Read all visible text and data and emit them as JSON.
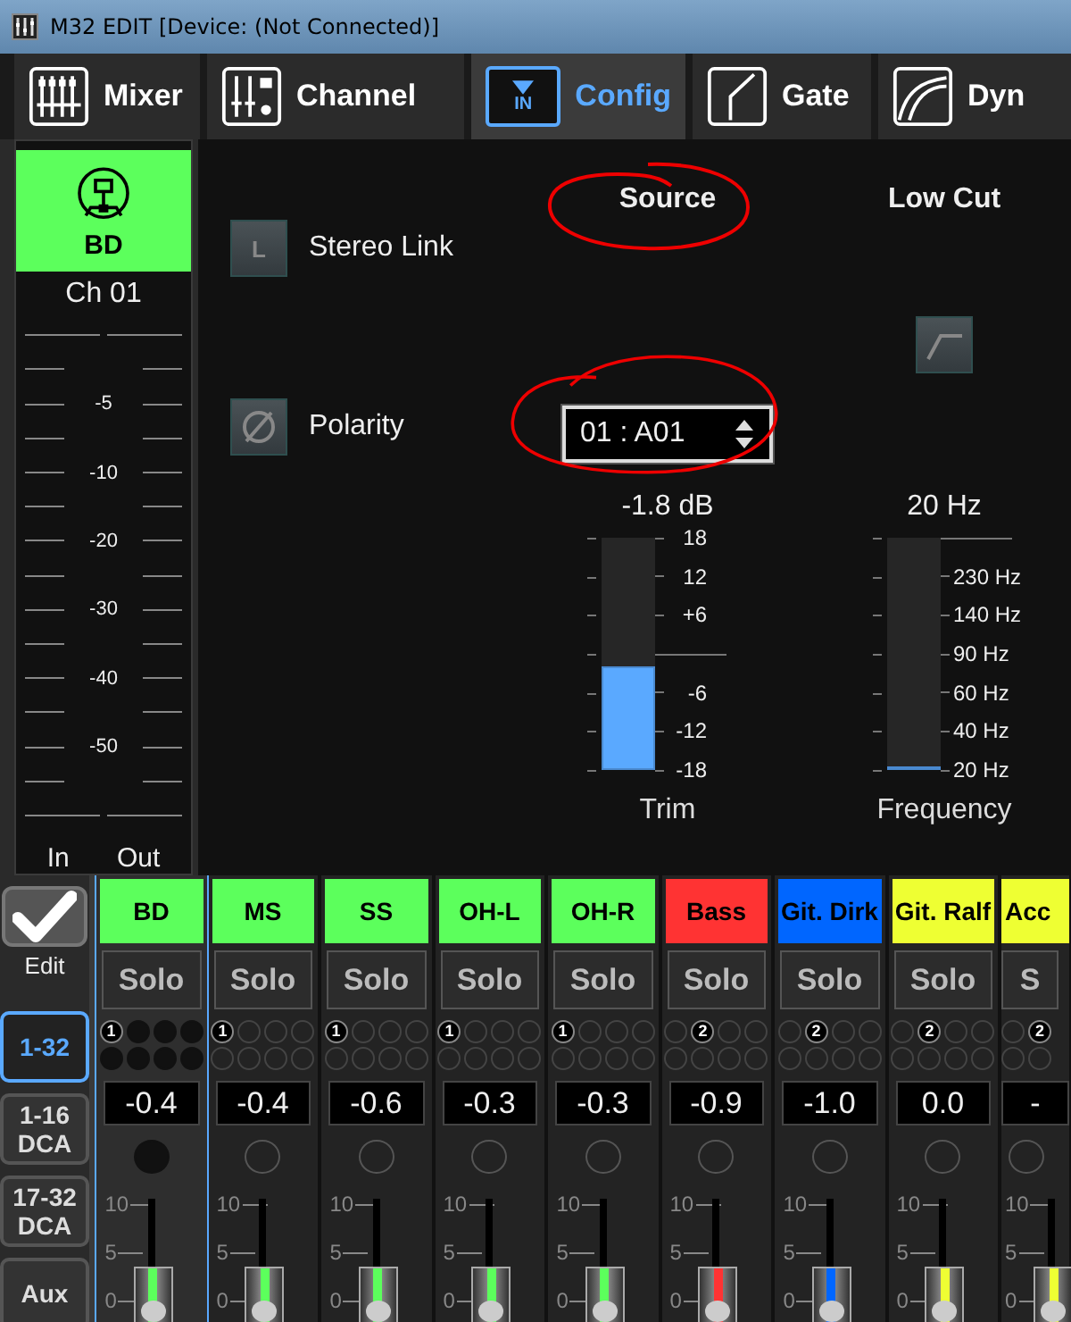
{
  "window": {
    "title": "M32 EDIT [Device: (Not Connected)]"
  },
  "tabs": [
    {
      "kind": "mixer",
      "label": "Mixer",
      "selected": false
    },
    {
      "kind": "channel",
      "label": "Channel",
      "selected": false
    },
    {
      "kind": "config",
      "label": "Config",
      "icon_text": "IN",
      "selected": true
    },
    {
      "kind": "gate",
      "label": "Gate",
      "selected": false
    },
    {
      "kind": "dyn",
      "label": "Dyn",
      "selected": false
    }
  ],
  "channel_panel": {
    "name": "BD",
    "color": "#5cff5c",
    "number": "Ch 01",
    "meter_labels": [
      "-5",
      "-10",
      "-20",
      "-30",
      "-40",
      "-50"
    ],
    "in_label": "In",
    "out_label": "Out"
  },
  "config": {
    "stereo_link": {
      "icon_text": "L",
      "label": "Stereo Link",
      "on": false
    },
    "polarity": {
      "label": "Polarity",
      "on": false
    },
    "source": {
      "title": "Source",
      "value": "01 : A01",
      "reading": "-1.8 dB",
      "label": "Trim",
      "level": 0.45,
      "ticks": [
        {
          "kind": "label",
          "label": "18"
        },
        {
          "kind": "label",
          "label": "12"
        },
        {
          "kind": "label",
          "label": "+6"
        },
        {
          "kind": "line"
        },
        {
          "kind": "label",
          "label": "-6"
        },
        {
          "kind": "label",
          "label": "-12"
        },
        {
          "kind": "label",
          "label": "-18"
        }
      ]
    },
    "low_cut": {
      "title": "Low Cut",
      "on": false,
      "reading": "20 Hz",
      "label": "Frequency",
      "level": 0,
      "ticks": [
        {
          "kind": "line"
        },
        {
          "kind": "label",
          "label": "230 Hz"
        },
        {
          "kind": "label",
          "label": "140 Hz"
        },
        {
          "kind": "label",
          "label": "90 Hz"
        },
        {
          "kind": "label",
          "label": "60 Hz"
        },
        {
          "kind": "label",
          "label": "40 Hz"
        },
        {
          "kind": "label",
          "label": "20 Hz"
        }
      ]
    }
  },
  "edit_button": {
    "label": "Edit"
  },
  "banks": [
    {
      "label": "1-32",
      "selected": true
    },
    {
      "label": "1-16 DCA",
      "selected": false
    },
    {
      "label": "17-32 DCA",
      "selected": false
    },
    {
      "label": "Aux",
      "selected": false
    }
  ],
  "strips": [
    {
      "name": "BD",
      "color": "#5cff5c",
      "selected": true,
      "solo_label": "Solo",
      "solo": false,
      "dots": [
        {
          "assigned": true,
          "label": "1"
        },
        {
          "assigned": false
        },
        {
          "assigned": false
        },
        {
          "assigned": false
        }
      ],
      "value": "-0.4",
      "scale": [
        "10",
        "5",
        "0"
      ]
    },
    {
      "name": "MS",
      "color": "#5cff5c",
      "selected": false,
      "solo_label": "Solo",
      "solo": false,
      "dots": [
        {
          "assigned": true,
          "label": "1"
        },
        {
          "assigned": false
        },
        {
          "assigned": false
        },
        {
          "assigned": false
        }
      ],
      "value": "-0.4",
      "scale": [
        "10",
        "5",
        "0"
      ]
    },
    {
      "name": "SS",
      "color": "#5cff5c",
      "selected": false,
      "solo_label": "Solo",
      "solo": false,
      "dots": [
        {
          "assigned": true,
          "label": "1"
        },
        {
          "assigned": false
        },
        {
          "assigned": false
        },
        {
          "assigned": false
        }
      ],
      "value": "-0.6",
      "scale": [
        "10",
        "5",
        "0"
      ]
    },
    {
      "name": "OH-L",
      "color": "#5cff5c",
      "selected": false,
      "solo_label": "Solo",
      "solo": false,
      "dots": [
        {
          "assigned": true,
          "label": "1"
        },
        {
          "assigned": false
        },
        {
          "assigned": false
        },
        {
          "assigned": false
        }
      ],
      "value": "-0.3",
      "scale": [
        "10",
        "5",
        "0"
      ]
    },
    {
      "name": "OH-R",
      "color": "#5cff5c",
      "selected": false,
      "solo_label": "Solo",
      "solo": false,
      "dots": [
        {
          "assigned": true,
          "label": "1"
        },
        {
          "assigned": false
        },
        {
          "assigned": false
        },
        {
          "assigned": false
        }
      ],
      "value": "-0.3",
      "scale": [
        "10",
        "5",
        "0"
      ]
    },
    {
      "name": "Bass",
      "color": "#ff3333",
      "selected": false,
      "solo_label": "Solo",
      "solo": false,
      "dots": [
        {
          "assigned": false
        },
        {
          "assigned": true,
          "label": "2"
        },
        {
          "assigned": false
        },
        {
          "assigned": false
        }
      ],
      "value": "-0.9",
      "scale": [
        "10",
        "5",
        "0"
      ]
    },
    {
      "name": "Git. Dirk",
      "color": "#0066ff",
      "selected": false,
      "solo_label": "Solo",
      "solo": false,
      "dots": [
        {
          "assigned": false
        },
        {
          "assigned": true,
          "label": "2"
        },
        {
          "assigned": false
        },
        {
          "assigned": false
        }
      ],
      "value": "-1.0",
      "scale": [
        "10",
        "5",
        "0"
      ]
    },
    {
      "name": "Git. Ralf",
      "color": "#eeff33",
      "selected": false,
      "solo_label": "Solo",
      "solo": false,
      "dots": [
        {
          "assigned": false
        },
        {
          "assigned": true,
          "label": "2"
        },
        {
          "assigned": false
        },
        {
          "assigned": false
        }
      ],
      "value": "0.0",
      "scale": [
        "10",
        "5",
        "0"
      ]
    },
    {
      "name": "Acc",
      "color": "#eeff33",
      "selected": false,
      "solo_label": "S",
      "solo": false,
      "dots": [
        {
          "assigned": false
        },
        {
          "assigned": true,
          "label": "2"
        }
      ],
      "value": "-",
      "scale": [
        "10",
        "5",
        "0"
      ]
    }
  ]
}
